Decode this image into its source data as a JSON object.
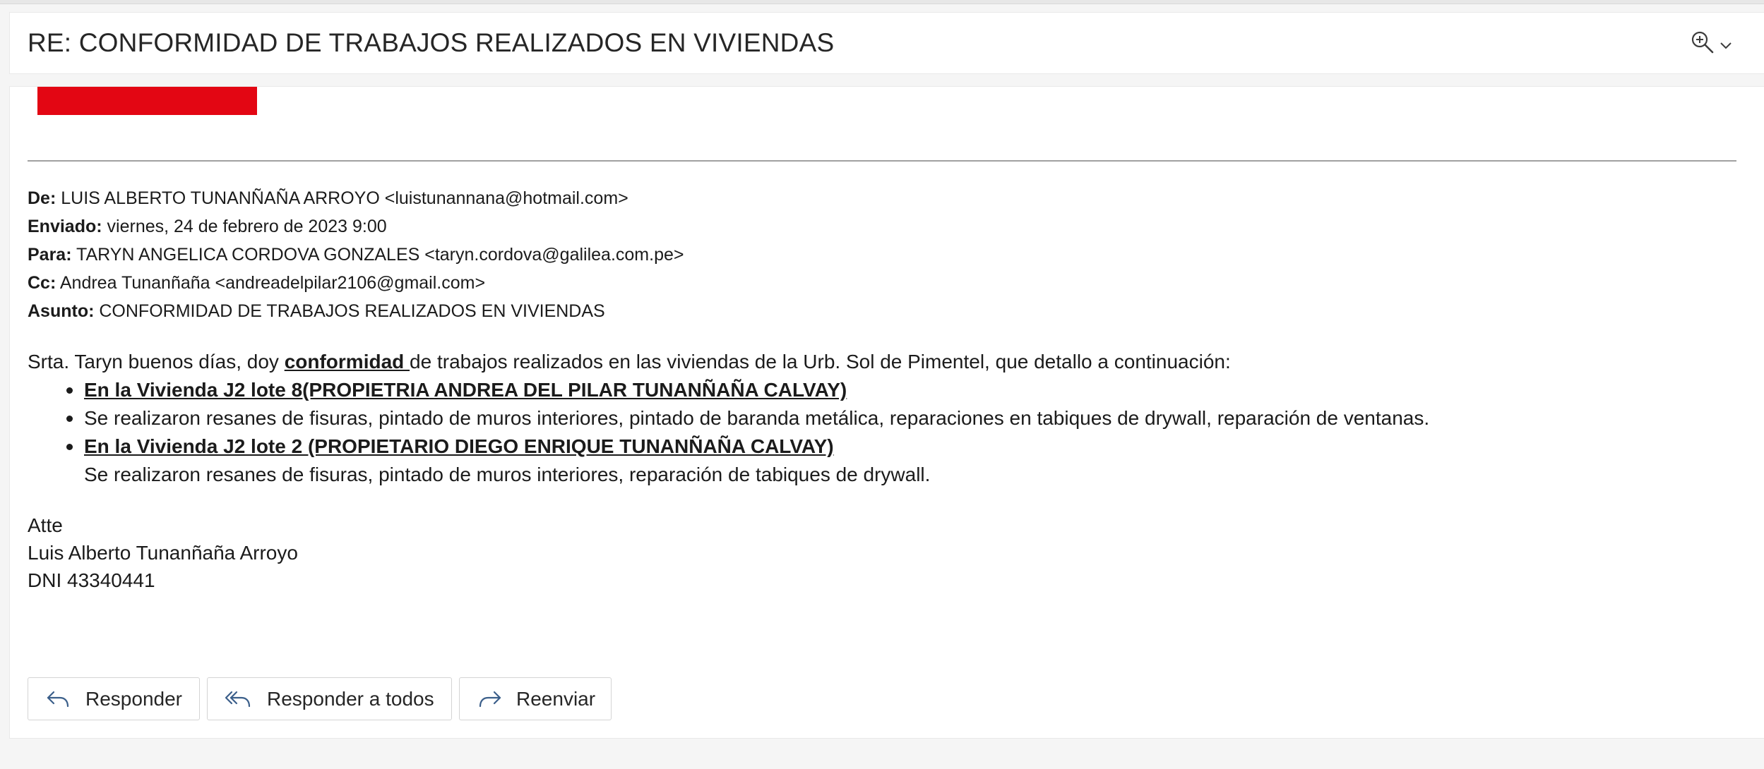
{
  "subject": {
    "title": "RE: CONFORMIDAD DE TRABAJOS REALIZADOS EN VIVIENDAS"
  },
  "headers": {
    "from_label": "De:",
    "from_value": "LUIS ALBERTO TUNANÑAÑA ARROYO <luistunannana@hotmail.com>",
    "sent_label": "Enviado:",
    "sent_value": "viernes, 24 de febrero de 2023 9:00",
    "to_label": "Para:",
    "to_value": "TARYN ANGELICA CORDOVA GONZALES <taryn.cordova@galilea.com.pe>",
    "cc_label": "Cc:",
    "cc_value": "Andrea Tunanñaña <andreadelpilar2106@gmail.com>",
    "subject_label": "Asunto:",
    "subject_value": "CONFORMIDAD DE TRABAJOS REALIZADOS EN VIVIENDAS"
  },
  "body": {
    "greeting_pre": "Srta. Taryn buenos días, doy ",
    "greeting_bold": "conformidad ",
    "greeting_post": "de trabajos realizados en las viviendas de la Urb. Sol de Pimentel, que detallo a continuación:",
    "item1_title": "En la Vivienda J2 lote 8(PROPIETRIA ANDREA DEL PILAR TUNANÑAÑA CALVAY) ",
    "item1_detail": "Se realizaron resanes de fisuras, pintado de muros interiores, pintado de baranda metálica, reparaciones en tabiques de drywall, reparación de ventanas.",
    "item2_title": "En la Vivienda J2 lote 2 (PROPIETARIO DIEGO ENRIQUE TUNANÑAÑA CALVAY)",
    "item2_detail": "Se realizaron resanes de fisuras, pintado de muros interiores,  reparación de tabiques de drywall.",
    "sign_closing": "Atte",
    "sign_name": "Luis Alberto Tunanñaña Arroyo",
    "sign_id": "DNI 43340441"
  },
  "actions": {
    "reply": "Responder",
    "reply_all": "Responder a todos",
    "forward": "Reenviar"
  },
  "icons": {
    "zoom": "zoom-in-icon",
    "chevron": "chevron-down-icon",
    "reply": "reply-icon",
    "reply_all": "reply-all-icon",
    "forward": "forward-icon"
  },
  "colors": {
    "redaction": "#e30613",
    "icon_blue": "#3b5f8a"
  }
}
